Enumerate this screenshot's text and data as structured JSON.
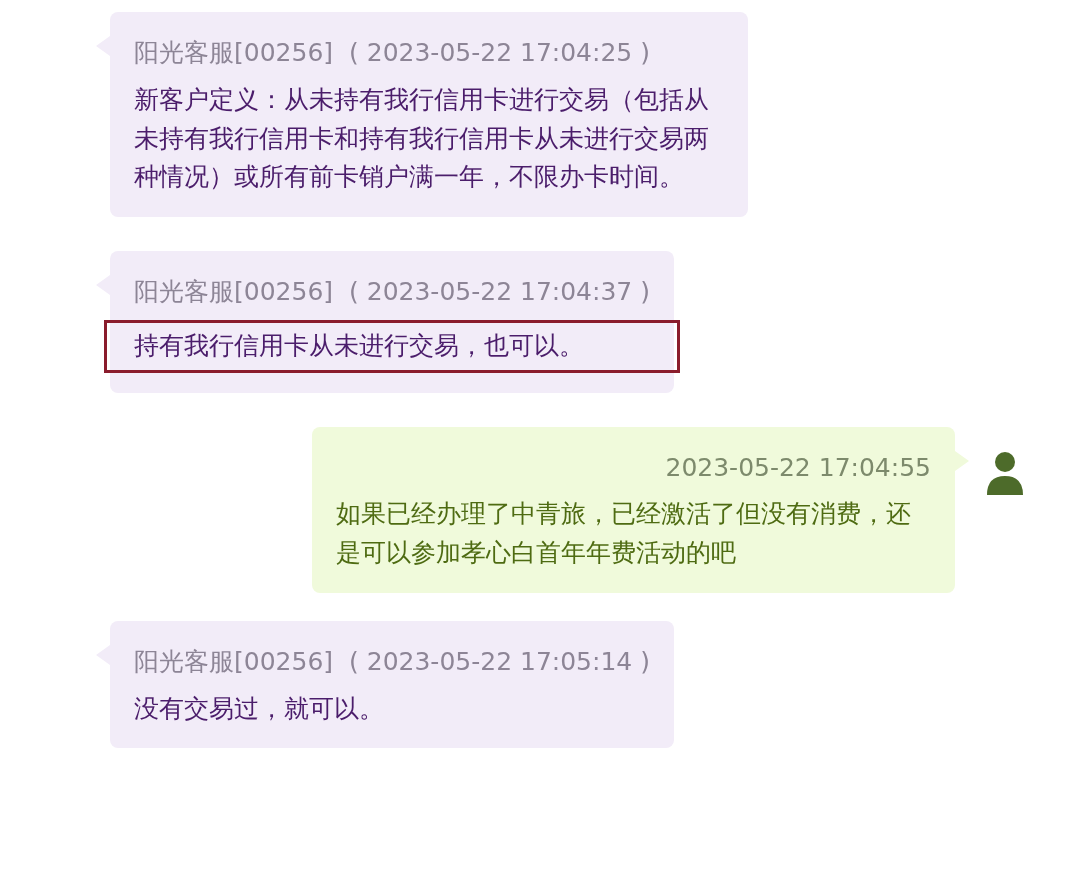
{
  "messages": [
    {
      "kind": "agent",
      "sender": "阳光客服[00256]",
      "time": "( 2023-05-22 17:04:25 )",
      "text": "新客户定义：从未持有我行信用卡进行交易（包括从未持有我行信用卡和持有我行信用卡从未进行交易两种情况）或所有前卡销户满一年，不限办卡时间。",
      "highlighted": false
    },
    {
      "kind": "agent",
      "sender": "阳光客服[00256]",
      "time": "( 2023-05-22 17:04:37 )",
      "text": "持有我行信用卡从未进行交易，也可以。",
      "highlighted": true
    },
    {
      "kind": "user",
      "time": "2023-05-22 17:04:55",
      "text": "如果已经办理了中青旅，已经激活了但没有消费，还是可以参加孝心白首年年费活动的吧",
      "highlighted": false
    },
    {
      "kind": "agent",
      "sender": "阳光客服[00256]",
      "time": "( 2023-05-22 17:05:14 )",
      "text": "没有交易过，就可以。",
      "highlighted": false
    }
  ]
}
